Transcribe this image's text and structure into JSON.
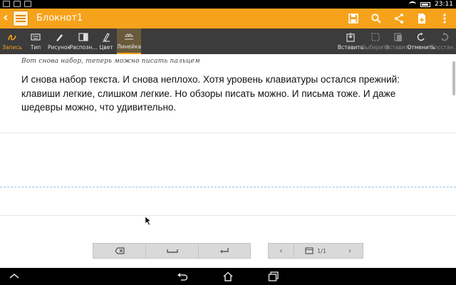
{
  "status_bar": {
    "time": "23:11"
  },
  "title_bar": {
    "title": "Блокнот1"
  },
  "toolbar": {
    "left_tools": [
      {
        "label": "Запись"
      },
      {
        "label": "Тип"
      },
      {
        "label": "Рисунок"
      },
      {
        "label": "Распозн..."
      },
      {
        "label": "Цвет"
      },
      {
        "label": "Линейка"
      }
    ],
    "right_tools": [
      {
        "label": "Вставить"
      },
      {
        "label": "Выберите"
      },
      {
        "label": "Вставить"
      },
      {
        "label": "Отменить"
      },
      {
        "label": "Восстан..."
      }
    ]
  },
  "document": {
    "handwriting": "Вот снова набор, теперь можно писать пальцем",
    "paragraph": "И снова набор текста. И снова неплохо. Хотя уровень клавиатуры остался прежний: клавиши легкие, слишком легкие. Но обзоры писать можно. И письма тоже. И даже шедевры можно, что удивительно."
  },
  "pager": {
    "page": "1/1"
  },
  "colors": {
    "accent": "#f7a21b",
    "toolbar": "#3c3c3c"
  }
}
